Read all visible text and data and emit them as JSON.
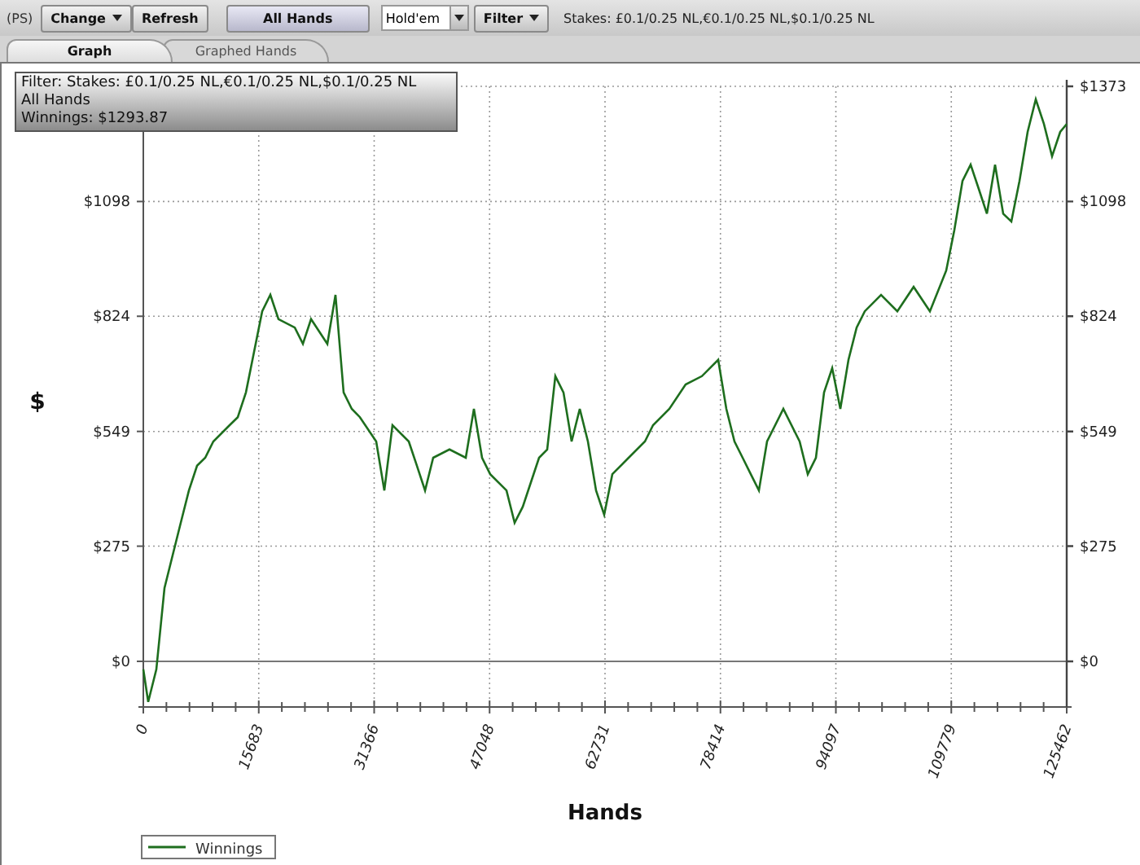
{
  "toolbar": {
    "site": "(PS)",
    "buttons": [
      {
        "label": "Change",
        "kind": "menu"
      },
      {
        "label": "Refresh",
        "kind": "plain"
      },
      {
        "label": "All Hands",
        "kind": "wide"
      }
    ],
    "game_select": {
      "value": "Hold'em"
    },
    "filter_button": {
      "label": "Filter"
    },
    "stakes": "Stakes: £0.1/0.25 NL,€0.1/0.25 NL,$0.1/0.25 NL"
  },
  "tabs": [
    {
      "label": "Graph",
      "selected": true
    },
    {
      "label": "Graphed Hands",
      "selected": false
    }
  ],
  "filter_box": {
    "lines": [
      "Filter: Stakes: £0.1/0.25 NL,€0.1/0.25 NL,$0.1/0.25 NL",
      "All Hands",
      "Winnings: $1293.87"
    ]
  },
  "chart": {
    "chart_data": {
      "type": "line",
      "grid": true,
      "xlabel": "Hands",
      "ylabel": "$",
      "xlim": [
        0,
        125462
      ],
      "ylim": [
        -109,
        1373
      ],
      "xticks": [
        0,
        15683,
        31366,
        47048,
        62731,
        78414,
        94097,
        109779,
        125462
      ],
      "yticks": [
        {
          "value": 0,
          "label": "$0"
        },
        {
          "value": 275,
          "label": "$275"
        },
        {
          "value": 549,
          "label": "$549"
        },
        {
          "value": 824,
          "label": "$824"
        },
        {
          "value": 1098,
          "label": "$1098"
        },
        {
          "value": 1373,
          "label": "$1373"
        }
      ],
      "x": [
        0,
        664,
        1770,
        2877,
        3983,
        5089,
        6196,
        7302,
        8408,
        9515,
        11727,
        12834,
        13940,
        15046,
        16153,
        17259,
        18365,
        20578,
        21684,
        22791,
        25004,
        26110,
        27216,
        28323,
        29429,
        31642,
        32748,
        33854,
        36067,
        37173,
        38280,
        39386,
        41599,
        43811,
        44918,
        46024,
        47131,
        49343,
        50450,
        51556,
        53769,
        54875,
        55981,
        57088,
        58194,
        59301,
        60407,
        61513,
        62619,
        63726,
        65939,
        68151,
        69258,
        71470,
        73683,
        75896,
        78108,
        79215,
        80321,
        81427,
        82534,
        83640,
        84746,
        86959,
        89172,
        90278,
        91385,
        92491,
        93597,
        94704,
        95810,
        96917,
        98023,
        100235,
        102448,
        104661,
        106874,
        109086,
        110193,
        111299,
        112405,
        113512,
        114618,
        115724,
        116831,
        117937,
        119044,
        120150,
        121256,
        122363,
        123469,
        124576,
        125462
      ],
      "series": [
        {
          "name": "Winnings",
          "color": "#1e6e1e",
          "values": [
            -19,
            -97,
            -19,
            175,
            253,
            331,
            408,
            467,
            486,
            525,
            564,
            583,
            642,
            739,
            836,
            875,
            817,
            797,
            758,
            817,
            758,
            875,
            642,
            603,
            583,
            525,
            408,
            564,
            525,
            467,
            408,
            486,
            506,
            486,
            603,
            486,
            447,
            408,
            331,
            369,
            486,
            506,
            681,
            642,
            525,
            603,
            525,
            408,
            350,
            447,
            486,
            525,
            564,
            603,
            661,
            681,
            720,
            603,
            525,
            486,
            447,
            408,
            525,
            603,
            525,
            447,
            486,
            642,
            700,
            603,
            720,
            797,
            836,
            875,
            836,
            894,
            836,
            933,
            1030,
            1147,
            1186,
            1128,
            1069,
            1186,
            1069,
            1050,
            1147,
            1264,
            1342,
            1283,
            1206,
            1264,
            1283
          ]
        }
      ]
    }
  }
}
